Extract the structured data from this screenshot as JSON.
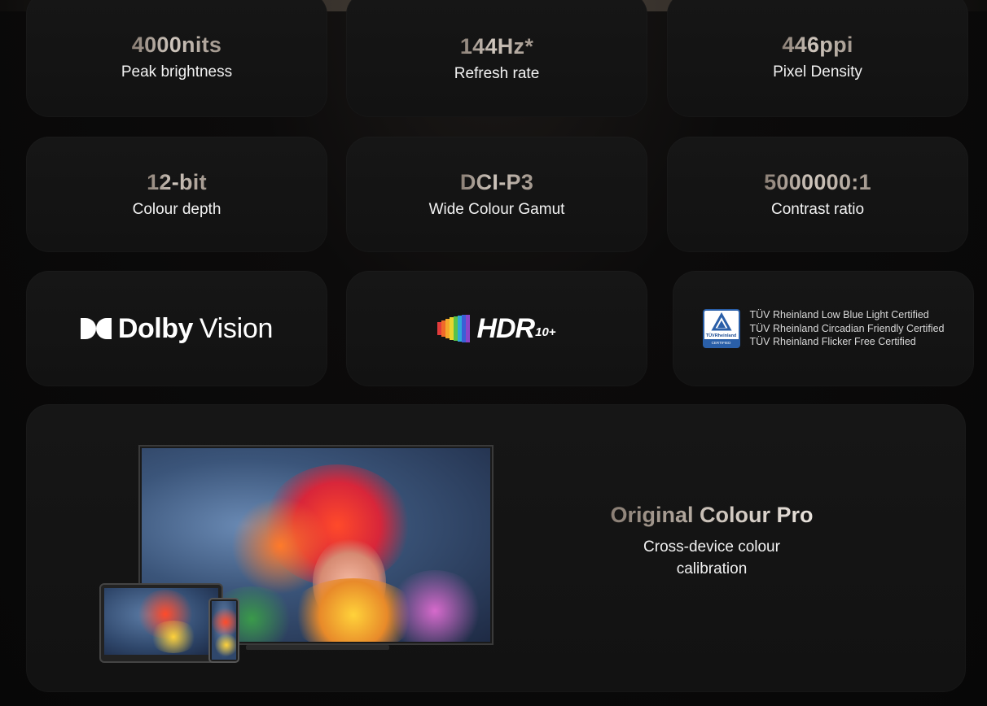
{
  "specs_row1": [
    {
      "value": "4000nits",
      "label": "Peak brightness"
    },
    {
      "value": "144Hz*",
      "label": "Refresh rate"
    },
    {
      "value": "446ppi",
      "label": "Pixel Density"
    }
  ],
  "specs_row2": [
    {
      "value": "12-bit",
      "label": "Colour depth"
    },
    {
      "value": "DCI-P3",
      "label": "Wide Colour Gamut"
    },
    {
      "value": "5000000:1",
      "label": "Contrast ratio"
    }
  ],
  "logos": {
    "dolby": {
      "word1": "Dolby",
      "word2": "Vision",
      "icon": "dolby-double-d-icon"
    },
    "hdr": {
      "word": "HDR",
      "sub": "10+",
      "icon": "hdr-rainbow-bars-icon"
    },
    "tuv": {
      "badge_name": "TÜVRheinland",
      "badge_caption": "CERTIFIED",
      "icon": "tuv-certified-badge-icon",
      "lines": [
        "TÜV Rheinland Low Blue Light Certified",
        "TÜV Rheinland Circadian Friendly Certified",
        "TÜV Rheinland Flicker Free Certified"
      ]
    }
  },
  "feature": {
    "title_part1": "Original",
    "title_part2": "Colour Pro",
    "desc_line1": "Cross-device colour",
    "desc_line2": "calibration"
  },
  "colors": {
    "background": "#0a0909",
    "card": "#141414",
    "value_gradient_start": "#8a7e74",
    "value_gradient_end": "#cfc6bd",
    "label": "#f2f2f2",
    "tuv_blue": "#2a5fa8"
  }
}
